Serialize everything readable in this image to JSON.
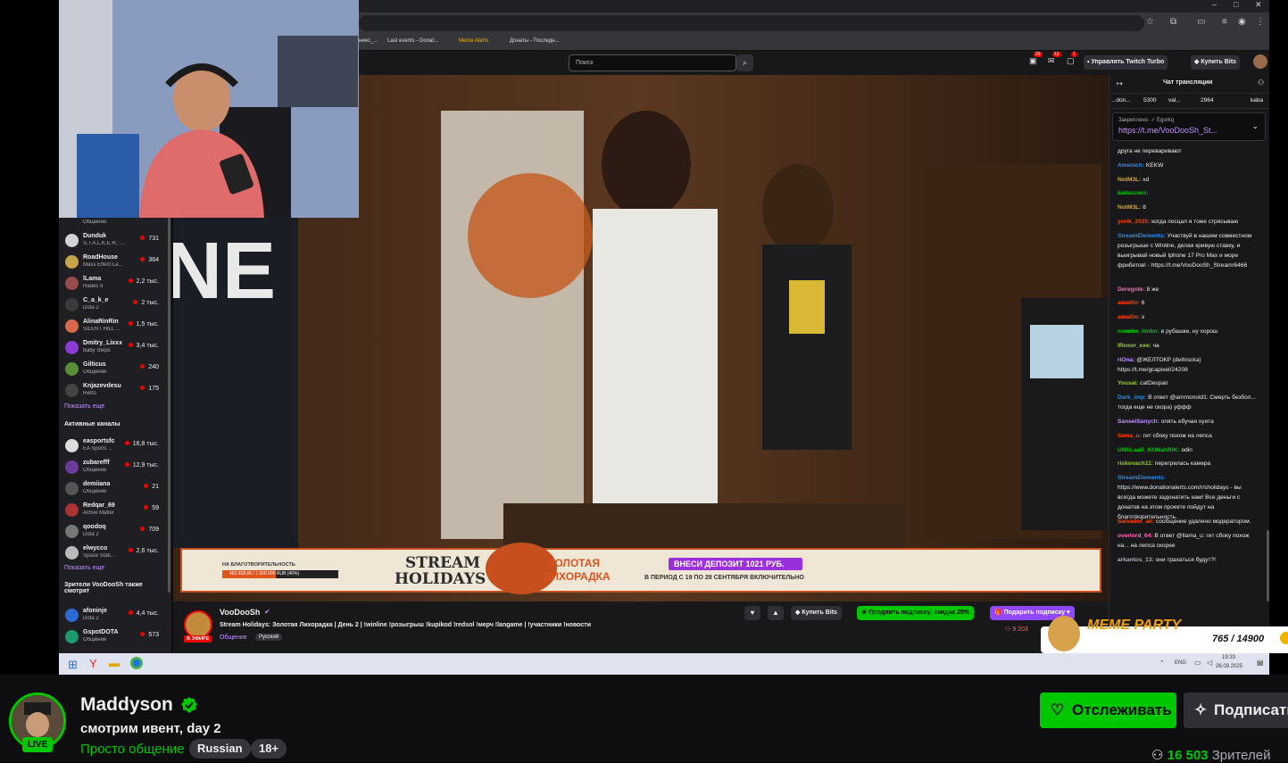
{
  "browser": {
    "window_controls": [
      "–",
      "□",
      "✕"
    ],
    "bookmarks": [
      "ниес_...",
      "Last events - Donat...",
      "Meme Alerts",
      "Донаты - Последн..."
    ]
  },
  "twitch_header": {
    "search_placeholder": "Поиск",
    "notifications": [
      {
        "icon": "inbox-icon",
        "count": "29"
      },
      {
        "icon": "mail-icon",
        "count": "12"
      },
      {
        "icon": "bell-icon",
        "count": "1"
      }
    ],
    "turbo_label": "Управлять Twitch Turbo",
    "bits_label": "Купить Bits"
  },
  "sidebar": {
    "followed": [
      {
        "name": "",
        "game": "Общение",
        "viewers": ""
      },
      {
        "name": "Dunduk",
        "game": "S.T.A.L.K.E.R.: ...",
        "viewers": "731",
        "color": "#cfd2d6"
      },
      {
        "name": "RoadHouse",
        "game": "Mass Effect Le...",
        "viewers": "364",
        "color": "#c9a44a"
      },
      {
        "name": "lLama",
        "game": "Hades II",
        "viewers": "2,2 тыс.",
        "color": "#9a4b4b"
      },
      {
        "name": "C_a_k_e",
        "game": "Dota 2",
        "viewers": "2 тыс.",
        "color": "#3a3a3a"
      },
      {
        "name": "AlinaRinRin",
        "game": "SILENT HILL ...",
        "viewers": "1,5 тыс.",
        "color": "#d9674c"
      },
      {
        "name": "Dmitry_Lixxx",
        "game": "Baby Steps",
        "viewers": "3,4 тыс.",
        "color": "#8a3bd4"
      },
      {
        "name": "Gilticus",
        "game": "Общение",
        "viewers": "240",
        "color": "#5a8f3a"
      },
      {
        "name": "Knjazevdesu",
        "game": "Retro",
        "viewers": "175",
        "color": "#444"
      }
    ],
    "show_more_1": "Показать еще",
    "active_heading": "Активные каналы",
    "active": [
      {
        "name": "easportsfc",
        "game": "EA Sports ...",
        "viewers": "16,8 тыс.",
        "color": "#ddd"
      },
      {
        "name": "zubarefff",
        "game": "Общение",
        "viewers": "12,9 тыс.",
        "color": "#6b3d9a"
      },
      {
        "name": "demiiana",
        "game": "Общение",
        "viewers": "21",
        "color": "#555"
      },
      {
        "name": "Redqar_69",
        "game": "Active Matter",
        "viewers": "59",
        "color": "#a33"
      },
      {
        "name": "qoodoq",
        "game": "Dota 2",
        "viewers": "709",
        "color": "#777"
      },
      {
        "name": "elwycco",
        "game": "Space Stati...",
        "viewers": "2,6 тыс.",
        "color": "#bbb"
      }
    ],
    "show_more_2": "Показать еще",
    "also_watch_heading": "Зрители VooDooSh также смотрят",
    "also_watch": [
      {
        "name": "afoninje",
        "game": "Dota 2",
        "viewers": "4,4 тыс.",
        "color": "#2b6bd8"
      },
      {
        "name": "GspotDOTA",
        "game": "Общение",
        "viewers": "573",
        "color": "#1c9a6e"
      }
    ]
  },
  "banner": {
    "charity_label": "НА БЛАГОТВОРИТЕЛЬНОСТЬ",
    "charity_progress": "463 818.66 / 1 000 000 RUB (46%)",
    "stream_label": "STREAM",
    "holidays_label": "HOLIDAYS",
    "gold_rush_line1": "ЗОЛОТАЯ",
    "gold_rush_line2": "ЛИХОРАДКА",
    "deposit_line1": "ВНЕСИ ДЕПОЗИТ 1021 РУБ.",
    "deposit_line2": "В ПЕРИОД С 19 ПО 28 СЕНТЯБРЯ ВКЛЮЧИТЕЛЬНО"
  },
  "stream_info": {
    "channel": "VooDooSh",
    "live_badge": "В ЭФИРЕ",
    "title": "Stream Holidays: Золотая Лихорадка | День 2 | !winline !розыгрыш !kupikod !redsol !мерч !langame | !участники !новости",
    "category": "Общение",
    "tag": "Русский",
    "bits_label": "Купить Bits",
    "renew_label": "Продлить подписку: скидка 25%",
    "gift_label": "Подарить подписку",
    "viewers": "9 203"
  },
  "chat": {
    "header": "Чат трансляции",
    "leaderboard": [
      "...don...",
      "5300",
      "val...",
      "2964",
      "kaba"
    ],
    "pinned_label": "Закреплено: ✓ Egorkq",
    "pinned_link": "https://t.me/VooDooSh_St...",
    "messages": [
      {
        "user": "",
        "color": "#efeff1",
        "text": "друга не переваривают"
      },
      {
        "user": "Amenich",
        "color": "#1e90ff",
        "text": "KEKW"
      },
      {
        "user": "NotM3L",
        "color": "#daa520",
        "text": "xd"
      },
      {
        "user": "kaitaszero",
        "color": "#00c700",
        "text": ""
      },
      {
        "user": "NotM3L",
        "color": "#daa520",
        "text": "8"
      },
      {
        "user": "yorik_2025",
        "color": "#ff4500",
        "text": "когда посцал я тоже стрясываю"
      },
      {
        "user": "StreamElements",
        "color": "#1e90ff",
        "text": "Участвуй в нашем совместном розыгрыше с Winline, делая кривую ставку, и выигрывай новый Iphone 17 Pro Max и море фрибетов! - https://t.me/VooDooSh_Stream/6466"
      },
      {
        "user": "Deregote",
        "color": "#ff69b4",
        "text": "8 же"
      },
      {
        "user": "amallin",
        "color": "#ff4500",
        "text": "6"
      },
      {
        "user": "amallin",
        "color": "#ff4500",
        "text": "э"
      },
      {
        "user": "mambo_limbo",
        "color": "#00c700",
        "text": "в рубашке, ну хорош"
      },
      {
        "user": "IRoxor_exe",
        "color": "#9acd32",
        "text": "ча"
      },
      {
        "user": "riOna",
        "color": "#bf94ff",
        "text": "@ЖЕЛТОКР (deihiscka) https://t.me/gcapixel/24208"
      },
      {
        "user": "Yousai",
        "color": "#9acd32",
        "text": "catDespair"
      },
      {
        "user": "Dark_imp",
        "color": "#1e90ff",
        "text": "В ответ @ammonoid1: Смерть безбол... тогда еще не скора) уффф"
      },
      {
        "user": "SanseiSanych",
        "color": "#bf94ff",
        "text": "опять ебучая хуита"
      },
      {
        "user": "llama_u",
        "color": "#ff4500",
        "text": "гит сбоку похож на лепса"
      },
      {
        "user": "UNSLaaD_KONahRIK",
        "color": "#00c700",
        "text": "odin"
      },
      {
        "user": "riskovach11",
        "color": "#9acd32",
        "text": "перегрелась камера"
      },
      {
        "user": "StreamElements",
        "color": "#1e90ff",
        "text": "https://www.donationalerts.com/r/sholidays - вы всегда можете задонатить нам! Все деньги с донатов на этом проекте пойдут на благотворительность."
      },
      {
        "user": "Salvador_ali",
        "color": "#ff4500",
        "text": "сообщение удалено модератором."
      },
      {
        "user": "overlord_64",
        "color": "#ff69b4",
        "text": "В ответ @llama_u: гит сбоку похож на... на лепса скорее"
      },
      {
        "user": "arkantos_13",
        "color": "#adadb8",
        "text": "они трахаться будут?!"
      }
    ]
  },
  "meme_party": {
    "label": "MEME PARTY",
    "progress": "765 / 14900"
  },
  "taskbar": {
    "time": "19:33",
    "date": "26.09.2025",
    "lang": "ENG"
  },
  "channel": {
    "name": "Maddyson",
    "live": "LIVE",
    "title": "смотрим ивент, day 2",
    "category": "Просто общение",
    "tags": [
      "Russian",
      "18+"
    ],
    "follow_label": "Отслеживать",
    "subscribe_label": "Подписаться",
    "viewers_count": "16 503",
    "viewers_label": "Зрителей",
    "accent": "#00c700"
  }
}
